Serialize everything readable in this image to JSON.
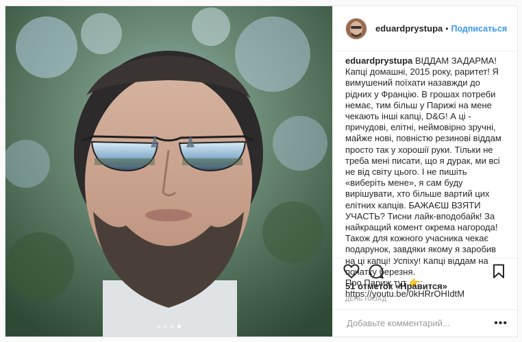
{
  "header": {
    "username": "eduardprystupa",
    "separator": "•",
    "follow_label": "Подписаться"
  },
  "caption": {
    "username": "eduardprystupa",
    "text": " ВІДДАМ ЗАДАРМА!\nКапці домашні, 2015 року, раритет! Я вимушений поїхати назавжди до рідних у Францію. В грошах потреби немає, тим більш у Парижі на мене чекають інші капці, D&G! А ці - причудові, елітні, неймовірно зручні, майже нові, повністю резинові віддам просто так у хорошії руки. Тільки не треба мені писати, що я дурак, ми всі не від світу цього. І не пишіть «виберіть мене», я сам буду вирішувати, хто більше вартий цих елітних капців. БАЖАЄШ ВЗЯТИ УЧАСТЬ? Тисни лайк-вподобайк! За найкращий комент окрема нагорода! Також для кожного учасника чекає подарунок, завдяки якому я заробив на ці капці! Успіху! Капці віддам на початку березня.\nПро Париж тут 👉:\nhttps://youtu.be/0kHRrOHIdtM"
  },
  "actions": {
    "like_icon": "heart-icon",
    "comment_icon": "comment-bubble-icon",
    "save_icon": "bookmark-icon"
  },
  "likes_text": "51 отметок «Нравится»",
  "timestamp": "ДЕНЬ НАЗАД",
  "comment": {
    "placeholder": "Добавьте комментарий...",
    "value": "",
    "more_label": "•••"
  },
  "carousel": {
    "count": 4,
    "active_index": 3
  },
  "colors": {
    "accent": "#3897f0",
    "text": "#262626",
    "muted": "#999999",
    "border": "#efefef"
  }
}
